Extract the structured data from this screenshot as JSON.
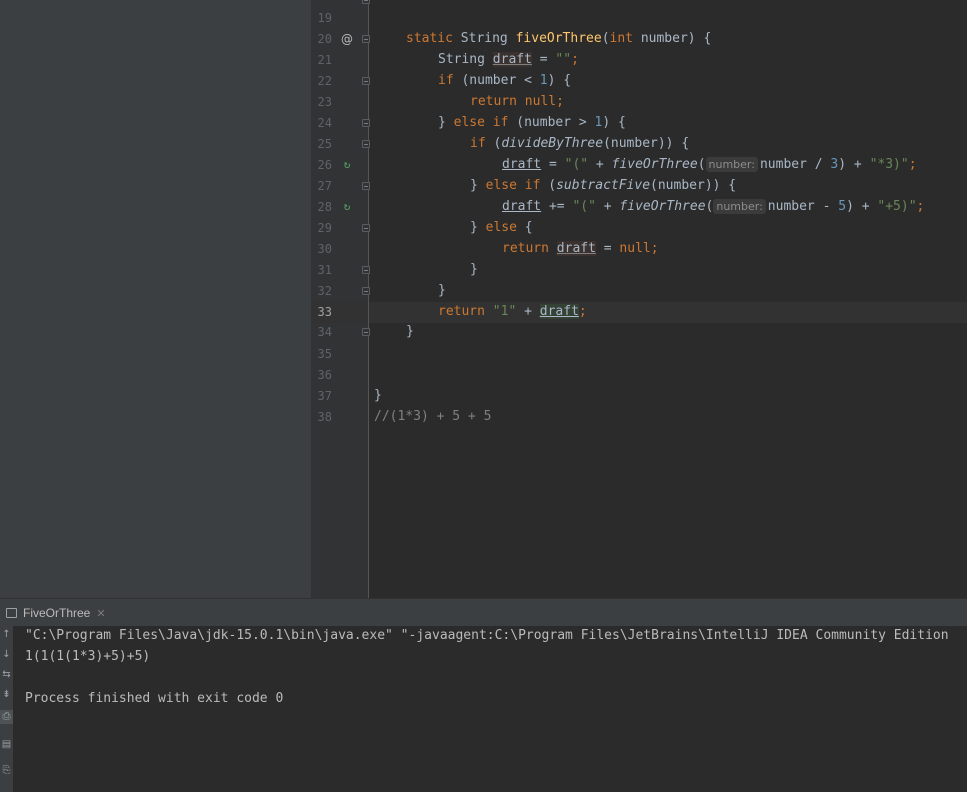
{
  "editor": {
    "line_numbers": [
      "19",
      "20",
      "21",
      "22",
      "23",
      "24",
      "25",
      "26",
      "27",
      "28",
      "29",
      "30",
      "31",
      "32",
      "33",
      "34",
      "35",
      "36",
      "37",
      "38"
    ],
    "gutter_icons": {
      "line20": "@",
      "line26": "↻",
      "line28": "↻"
    },
    "hint_number": "number:",
    "tokens": {
      "kw_static": "static",
      "t_string": "String",
      "m_fiveOrThree": "fiveOrThree",
      "p_open": "(",
      "kw_int": "int",
      "p_number_sig": " number) {",
      "v_draft": "draft",
      "eq": " = ",
      "s_empty": "\"\"",
      "semi": ";",
      "kw_if": "if",
      "cond1a": " (number < ",
      "n1": "1",
      "cond_close": ") {",
      "kw_return": "return",
      "kw_null": "null",
      "brace_else": "} ",
      "kw_else": "else",
      "cond2a": " (number > ",
      "cond3a": " (",
      "m_divideByThree": "divideByThree",
      "cond3b": "(number)) {",
      "s_paren": "\"(\"",
      "plus": " + ",
      "call_open": "(",
      "div_expr": "number / ",
      "n3": "3",
      "close_plus": ") + ",
      "s_times3": "\"*3)\"",
      "m_subtractFive": "subtractFive",
      "pluseq": " += ",
      "sub_expr": "number - ",
      "n5": "5",
      "s_plus5": "\"+5)\"",
      "else_open": " {",
      "eq_null": " = ",
      "close_brace": "}",
      "s_one": "\"1\"",
      "comment": "//(1*3) + 5 + 5"
    }
  },
  "run_panel": {
    "tab_label": "FiveOrThree",
    "tab_close": "✕",
    "console": [
      "\"C:\\Program Files\\Java\\jdk-15.0.1\\bin\\java.exe\" \"-javaagent:C:\\Program Files\\JetBrains\\IntelliJ IDEA Community Edition",
      "1(1(1(1*3)+5)+5)",
      "",
      "Process finished with exit code 0"
    ],
    "tool_icons": [
      "↑",
      "↓",
      "⇆",
      "⇟",
      "⎙",
      "▤",
      "⎘"
    ]
  },
  "colors": {
    "keyword": "#cc7832",
    "string": "#6a8759",
    "number": "#6897bb",
    "method": "#ffc66d",
    "text": "#a9b7c6",
    "background": "#2b2b2b"
  }
}
